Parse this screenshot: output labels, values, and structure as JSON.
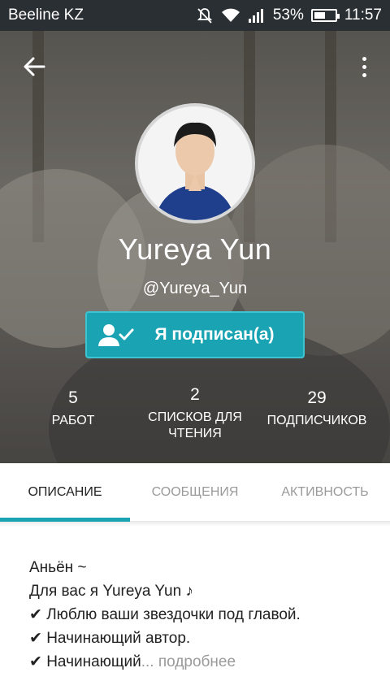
{
  "status_bar": {
    "carrier": "Beeline KZ",
    "battery_percent": "53%",
    "battery_level": 0.53,
    "time": "11:57",
    "icons": [
      "mute-icon",
      "wifi-icon",
      "signal-icon",
      "battery-icon"
    ]
  },
  "profile": {
    "display_name": "Yureya Yun",
    "username": "@Yureya_Yun",
    "follow_button_label": "Я подписан(а)",
    "stats": [
      {
        "value": "5",
        "label": "РАБОТ"
      },
      {
        "value": "2",
        "label": "СПИСКОВ ДЛЯ ЧТЕНИЯ"
      },
      {
        "value": "29",
        "label": "ПОДПИСЧИКОВ"
      }
    ]
  },
  "tabs": [
    {
      "label": "ОПИСАНИЕ",
      "active": true
    },
    {
      "label": "СООБЩЕНИЯ",
      "active": false
    },
    {
      "label": "АКТИВНОСТЬ",
      "active": false
    }
  ],
  "description": {
    "lines": [
      "Аньён ~",
      "Для вас я Yureya Yun ♪",
      "✔ Люблю ваши звездочки под главой.",
      "✔ Начинающий автор.",
      "✔ Начинающий"
    ],
    "ellipsis": "...",
    "more_link": "подробнее"
  },
  "colors": {
    "accent": "#1aa3b3",
    "status_bar": "#2a2f33"
  }
}
